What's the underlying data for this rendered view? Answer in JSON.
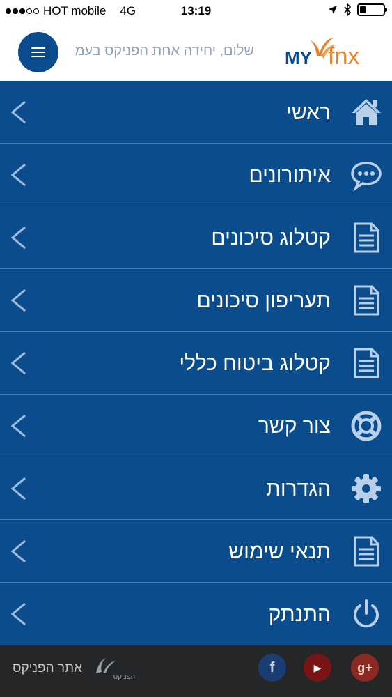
{
  "status_bar": {
    "carrier": "HOT mobile",
    "network": "4G",
    "time": "13:19",
    "signal_dots_filled": 3,
    "signal_dots_total": 5
  },
  "header": {
    "greeting": "שלום, יחידה אחת הפניקס בעמ",
    "logo_my": "MY",
    "logo_fnx": "fnx",
    "menu_icon": "hamburger-icon",
    "colors": {
      "primary": "#0b4c8c",
      "logo_orange": "#e8802a",
      "greeting": "#8da0b4"
    }
  },
  "menu": {
    "items": [
      {
        "label": "ראשי",
        "icon": "home-icon"
      },
      {
        "label": "איתורונים",
        "icon": "chat-bubble-icon"
      },
      {
        "label": "קטלוג סיכונים",
        "icon": "document-icon"
      },
      {
        "label": "תעריפון סיכונים",
        "icon": "document-icon"
      },
      {
        "label": "קטלוג ביטוח כללי",
        "icon": "document-icon"
      },
      {
        "label": "צור קשר",
        "icon": "lifebuoy-icon"
      },
      {
        "label": "הגדרות",
        "icon": "gear-icon"
      },
      {
        "label": "תנאי שימוש",
        "icon": "document-icon"
      },
      {
        "label": "התנתק",
        "icon": "power-icon"
      }
    ],
    "chevron_icon": "chevron-left-icon"
  },
  "footer": {
    "site_link": "אתר הפניקס",
    "logo_text": "הפניקס",
    "social": [
      {
        "name": "facebook",
        "glyph": "f"
      },
      {
        "name": "youtube",
        "glyph": "▶"
      },
      {
        "name": "google-plus",
        "glyph": "g+"
      }
    ]
  }
}
